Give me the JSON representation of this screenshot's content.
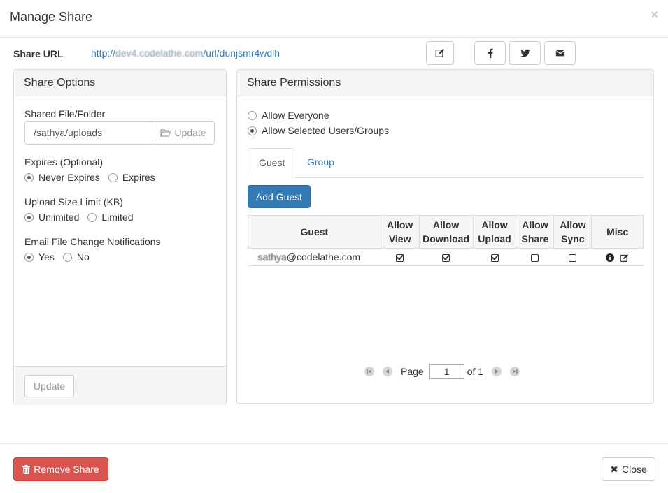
{
  "modal": {
    "title": "Manage Share",
    "close_glyph": "×"
  },
  "share_url": {
    "label": "Share URL",
    "url_prefix": "http://",
    "url_redacted": "dev4.codelathe.com",
    "url_suffix": "/url/dunjsmr4wdlh",
    "buttons": [
      {
        "icon": "edit-icon"
      },
      {
        "icon": "facebook-icon"
      },
      {
        "icon": "twitter-icon"
      },
      {
        "icon": "email-icon"
      }
    ]
  },
  "share_options": {
    "heading": "Share Options",
    "shared_path_label": "Shared File/Folder",
    "shared_path_value": "/sathya/uploads",
    "path_update_label": "Update",
    "expires_label": "Expires (Optional)",
    "expires_options": [
      "Never Expires",
      "Expires"
    ],
    "expires_selected": "Never Expires",
    "upload_limit_label": "Upload Size Limit (KB)",
    "upload_limit_options": [
      "Unlimited",
      "Limited"
    ],
    "upload_limit_selected": "Unlimited",
    "notifications_label": "Email File Change Notifications",
    "notifications_options": [
      "Yes",
      "No"
    ],
    "notifications_selected": "Yes",
    "update_button": "Update"
  },
  "share_permissions": {
    "heading": "Share Permissions",
    "access_options": [
      "Allow Everyone",
      "Allow Selected Users/Groups"
    ],
    "access_selected": "Allow Selected Users/Groups",
    "tabs": [
      "Guest",
      "Group"
    ],
    "active_tab": "Guest",
    "add_guest_button": "Add Guest",
    "columns": [
      "Guest",
      "Allow View",
      "Allow Download",
      "Allow Upload",
      "Allow Share",
      "Allow Sync",
      "Misc"
    ],
    "rows": [
      {
        "guest_redacted": "sathya",
        "guest_domain": "@codelathe.com",
        "allow_view": true,
        "allow_download": true,
        "allow_upload": true,
        "allow_share": false,
        "allow_sync": false,
        "misc_icons": [
          "info-icon",
          "edit-icon"
        ]
      }
    ],
    "pager": {
      "page_label": "Page",
      "current_page": "1",
      "of_label": "of 1"
    }
  },
  "footer": {
    "remove_share": "Remove Share",
    "close": "Close"
  }
}
